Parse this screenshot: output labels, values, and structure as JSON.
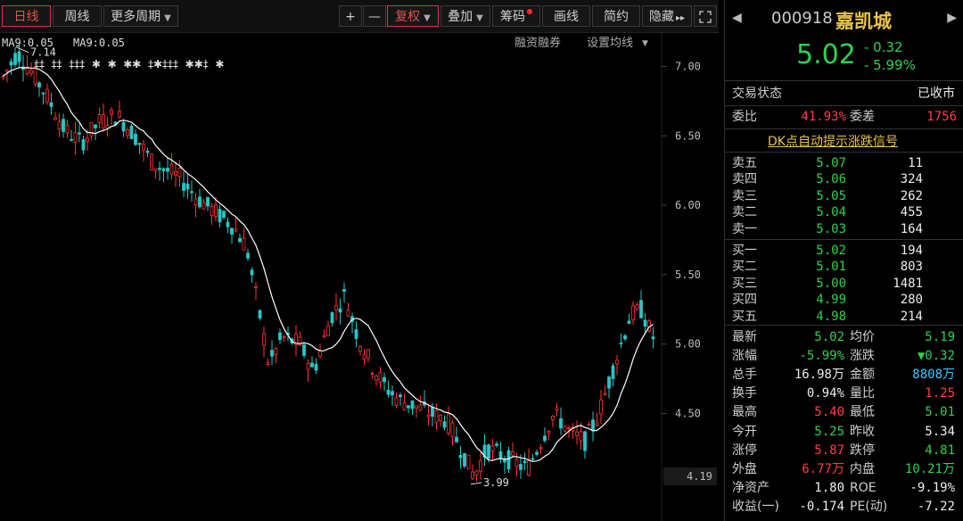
{
  "toolbar": {
    "day": "日线",
    "week": "周线",
    "more": "更多周期",
    "plus": "+",
    "minus": "—",
    "restore": "复权",
    "overlay": "叠加",
    "chips": "筹码",
    "draw": "画线",
    "simple": "简约",
    "hide": "隐藏",
    "more_arrow": "▸▸",
    "expand_icon": "expand-icon"
  },
  "chart_header": {
    "ma_label_1": "MA9:0.05",
    "ma_label_2": "MA9:0.05",
    "margin_trading": "融资融券",
    "ma_settings": "设置均线"
  },
  "chart_data": {
    "type": "candlestick",
    "y_ticks": [
      "7.00",
      "6.50",
      "6.00",
      "5.50",
      "5.00",
      "4.50"
    ],
    "y_values": [
      7.0,
      6.5,
      6.0,
      5.5,
      5.0,
      4.5
    ],
    "ylim": [
      3.9,
      7.15
    ],
    "last_price_label": "4.19",
    "high_marker": "7.14",
    "low_marker": "3.99",
    "signal_marks": "‡‡  ‡‡  ‡‡‡  ✱  ✱  ✱✱  ‡✱‡‡‡  ✱✱‡  ✱",
    "up_color": "#ff3333",
    "down_color": "#27c6c6",
    "ma_color": "#ffffff"
  },
  "quote": {
    "code": "000918",
    "name": "嘉凯城",
    "price": "5.02",
    "change": "- 0.32",
    "change_pct": "- 5.99%",
    "trade_state_label": "交易状态",
    "trade_state": "已收市",
    "weibi_label": "委比",
    "weibi": "41.93%",
    "weicha_label": "委差",
    "weicha": "1756",
    "signal_link": "DK点自动提示涨跌信号",
    "sell": [
      {
        "label": "卖五",
        "price": "5.07",
        "vol": "11"
      },
      {
        "label": "卖四",
        "price": "5.06",
        "vol": "324"
      },
      {
        "label": "卖三",
        "price": "5.05",
        "vol": "262"
      },
      {
        "label": "卖二",
        "price": "5.04",
        "vol": "455"
      },
      {
        "label": "卖一",
        "price": "5.03",
        "vol": "164"
      }
    ],
    "buy": [
      {
        "label": "买一",
        "price": "5.02",
        "vol": "194"
      },
      {
        "label": "买二",
        "price": "5.01",
        "vol": "803"
      },
      {
        "label": "买三",
        "price": "5.00",
        "vol": "1481"
      },
      {
        "label": "买四",
        "price": "4.99",
        "vol": "280"
      },
      {
        "label": "买五",
        "price": "4.98",
        "vol": "214"
      }
    ],
    "stats": [
      {
        "l1": "最新",
        "v1": "5.02",
        "c1": "g",
        "l2": "均价",
        "v2": "5.19",
        "c2": "g"
      },
      {
        "l1": "涨幅",
        "v1": "-5.99%",
        "c1": "g",
        "l2": "涨跌",
        "v2": "▼0.32",
        "c2": "g"
      },
      {
        "l1": "总手",
        "v1": "16.98万",
        "c1": "w",
        "l2": "金额",
        "v2": "8808万",
        "c2": "c"
      },
      {
        "l1": "换手",
        "v1": "0.94%",
        "c1": "w",
        "l2": "量比",
        "v2": "1.25",
        "c2": "r"
      },
      {
        "l1": "最高",
        "v1": "5.40",
        "c1": "r",
        "l2": "最低",
        "v2": "5.01",
        "c2": "g"
      },
      {
        "l1": "今开",
        "v1": "5.25",
        "c1": "g",
        "l2": "昨收",
        "v2": "5.34",
        "c2": "w"
      },
      {
        "l1": "涨停",
        "v1": "5.87",
        "c1": "r",
        "l2": "跌停",
        "v2": "4.81",
        "c2": "g"
      },
      {
        "l1": "外盘",
        "v1": "6.77万",
        "c1": "r",
        "l2": "内盘",
        "v2": "10.21万",
        "c2": "g"
      },
      {
        "l1": "净资产",
        "v1": "1.80",
        "c1": "w",
        "l2": "ROE",
        "v2": "-9.19%",
        "c2": "w"
      },
      {
        "l1": "收益(一)",
        "v1": "-0.174",
        "c1": "w",
        "l2": "PE(动)",
        "v2": "-7.22",
        "c2": "w"
      }
    ]
  }
}
